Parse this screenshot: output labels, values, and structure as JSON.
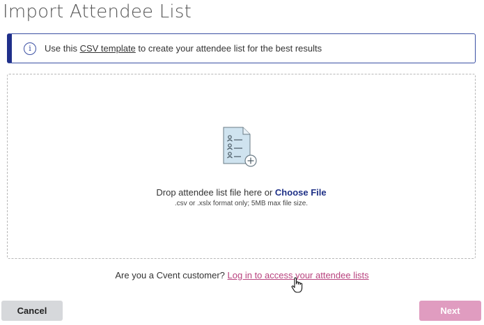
{
  "page": {
    "title": "Import Attendee List"
  },
  "banner": {
    "icon": "info-icon",
    "text_before": "Use this ",
    "link_text": "CSV template",
    "text_after": " to create your attendee list for the best results",
    "accent_color": "#1f2f8a"
  },
  "dropzone": {
    "icon": "attendee-file-add-icon",
    "drop_text": "Drop attendee list file here or ",
    "choose_file_label": "Choose File",
    "format_hint": ".csv or .xslx format only; 5MB max file size."
  },
  "customer": {
    "question": "Are you a Cvent customer? ",
    "login_link": "Log in to access your attendee lists",
    "link_color": "#b8427e"
  },
  "footer": {
    "cancel_label": "Cancel",
    "next_label": "Next",
    "next_color": "#e09cc0"
  }
}
